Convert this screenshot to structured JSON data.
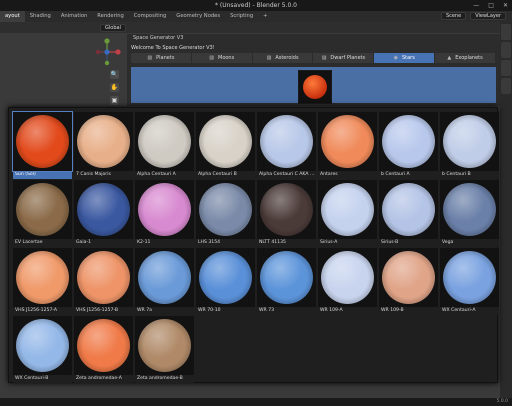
{
  "window": {
    "title": "* (Unsaved) - Blender 5.0.0",
    "controls": [
      "—",
      "□",
      "✕"
    ]
  },
  "menubar": {
    "tabs": [
      "ayout",
      "Shading",
      "Animation",
      "Rendering",
      "Compositing",
      "Geometry Nodes",
      "Scripting",
      "+"
    ],
    "active_index": 0,
    "scene_label": "Scene",
    "viewlayer_label": "ViewLayer"
  },
  "viewport": {
    "transform_orientation": "Global"
  },
  "addon": {
    "panel_title": "Space Generator V3",
    "welcome": "Welcome To Space Generator V3!",
    "tabs": [
      {
        "label": "Planets",
        "icon": "planet-icon"
      },
      {
        "label": "Moons",
        "icon": "moon-icon"
      },
      {
        "label": "Asteroids",
        "icon": "asteroid-icon"
      },
      {
        "label": "Dwarf Planets",
        "icon": "dwarf-planet-icon"
      },
      {
        "label": "Stars",
        "icon": "star-icon"
      },
      {
        "label": "Exoplanets",
        "icon": "exoplanet-icon"
      }
    ],
    "active_tab": 4
  },
  "gallery": {
    "selected_index": 0,
    "items": [
      {
        "label": "Sun (Sol)",
        "color": "#e24a1c"
      },
      {
        "label": "7 Canis Majoris",
        "color": "#e8b08a"
      },
      {
        "label": "Alpha Centauri A",
        "color": "#cfcac2"
      },
      {
        "label": "Alpha Centauri B",
        "color": "#d8d2c8"
      },
      {
        "label": "Alpha Centauri C AKA Pr...",
        "color": "#b8c8e8"
      },
      {
        "label": "Antares",
        "color": "#f08a5a"
      },
      {
        "label": "b Centauri A",
        "color": "#b8c8ec"
      },
      {
        "label": "b Centauri B",
        "color": "#c0cde8"
      },
      {
        "label": "EV Lacertae",
        "color": "#8a6a48"
      },
      {
        "label": "Gaia-1",
        "color": "#3a58a0"
      },
      {
        "label": "K2-11",
        "color": "#d88ad0"
      },
      {
        "label": "LHS 3154",
        "color": "#7a8aa8"
      },
      {
        "label": "NLTT 41135",
        "color": "#4a3a38"
      },
      {
        "label": "Sirius-A",
        "color": "#c4d2ee"
      },
      {
        "label": "Sirius-B",
        "color": "#b4c4e6"
      },
      {
        "label": "Vega",
        "color": "#6a80a8"
      },
      {
        "label": "VHS J1256-1257-A",
        "color": "#f09a6a"
      },
      {
        "label": "VHS J1256-1257-B",
        "color": "#ee9468"
      },
      {
        "label": "WR 7a",
        "color": "#6a9ad8"
      },
      {
        "label": "WR 70-10",
        "color": "#5a90d8"
      },
      {
        "label": "WR 73",
        "color": "#5c94da"
      },
      {
        "label": "WR 109-A",
        "color": "#c8d4ee"
      },
      {
        "label": "WR 109-B",
        "color": "#e0a488"
      },
      {
        "label": "WX Centauri-A",
        "color": "#7aa2e0"
      },
      {
        "label": "WX Centauri-B",
        "color": "#94b8e8"
      },
      {
        "label": "Zeta andromedae-A",
        "color": "#f07a48"
      },
      {
        "label": "Zeta andromedae-B",
        "color": "#b08a68"
      }
    ]
  },
  "statusbar": {
    "version": "5.0.0"
  }
}
